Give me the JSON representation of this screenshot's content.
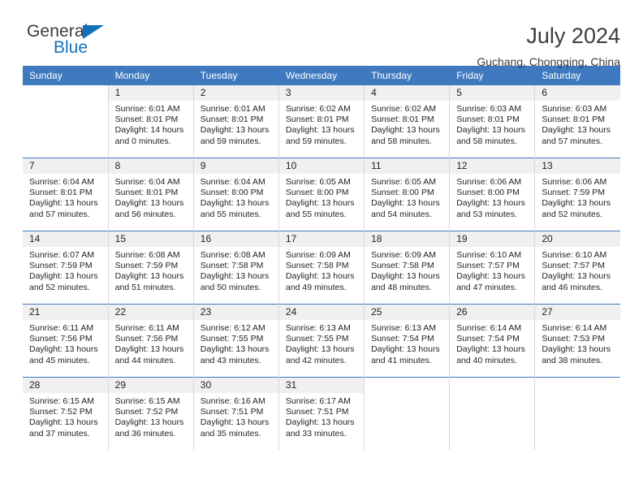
{
  "brand": {
    "name_part1": "General",
    "name_part2": "Blue"
  },
  "header": {
    "title": "July 2024",
    "location": "Guchang, Chongqing, China"
  },
  "weekday_headers": [
    "Sunday",
    "Monday",
    "Tuesday",
    "Wednesday",
    "Thursday",
    "Friday",
    "Saturday"
  ],
  "colors": {
    "header_blue": "#3f79bf",
    "brand_blue": "#1071b9",
    "daynum_band": "#f0f0f0",
    "text": "#231f20",
    "cell_divider": "#d8d8d8"
  },
  "weeks": [
    [
      {
        "day": "",
        "sunrise": "",
        "sunset": "",
        "daylight": "",
        "empty": true
      },
      {
        "day": "1",
        "sunrise": "Sunrise: 6:01 AM",
        "sunset": "Sunset: 8:01 PM",
        "daylight": "Daylight: 14 hours and 0 minutes."
      },
      {
        "day": "2",
        "sunrise": "Sunrise: 6:01 AM",
        "sunset": "Sunset: 8:01 PM",
        "daylight": "Daylight: 13 hours and 59 minutes."
      },
      {
        "day": "3",
        "sunrise": "Sunrise: 6:02 AM",
        "sunset": "Sunset: 8:01 PM",
        "daylight": "Daylight: 13 hours and 59 minutes."
      },
      {
        "day": "4",
        "sunrise": "Sunrise: 6:02 AM",
        "sunset": "Sunset: 8:01 PM",
        "daylight": "Daylight: 13 hours and 58 minutes."
      },
      {
        "day": "5",
        "sunrise": "Sunrise: 6:03 AM",
        "sunset": "Sunset: 8:01 PM",
        "daylight": "Daylight: 13 hours and 58 minutes."
      },
      {
        "day": "6",
        "sunrise": "Sunrise: 6:03 AM",
        "sunset": "Sunset: 8:01 PM",
        "daylight": "Daylight: 13 hours and 57 minutes."
      }
    ],
    [
      {
        "day": "7",
        "sunrise": "Sunrise: 6:04 AM",
        "sunset": "Sunset: 8:01 PM",
        "daylight": "Daylight: 13 hours and 57 minutes."
      },
      {
        "day": "8",
        "sunrise": "Sunrise: 6:04 AM",
        "sunset": "Sunset: 8:01 PM",
        "daylight": "Daylight: 13 hours and 56 minutes."
      },
      {
        "day": "9",
        "sunrise": "Sunrise: 6:04 AM",
        "sunset": "Sunset: 8:00 PM",
        "daylight": "Daylight: 13 hours and 55 minutes."
      },
      {
        "day": "10",
        "sunrise": "Sunrise: 6:05 AM",
        "sunset": "Sunset: 8:00 PM",
        "daylight": "Daylight: 13 hours and 55 minutes."
      },
      {
        "day": "11",
        "sunrise": "Sunrise: 6:05 AM",
        "sunset": "Sunset: 8:00 PM",
        "daylight": "Daylight: 13 hours and 54 minutes."
      },
      {
        "day": "12",
        "sunrise": "Sunrise: 6:06 AM",
        "sunset": "Sunset: 8:00 PM",
        "daylight": "Daylight: 13 hours and 53 minutes."
      },
      {
        "day": "13",
        "sunrise": "Sunrise: 6:06 AM",
        "sunset": "Sunset: 7:59 PM",
        "daylight": "Daylight: 13 hours and 52 minutes."
      }
    ],
    [
      {
        "day": "14",
        "sunrise": "Sunrise: 6:07 AM",
        "sunset": "Sunset: 7:59 PM",
        "daylight": "Daylight: 13 hours and 52 minutes."
      },
      {
        "day": "15",
        "sunrise": "Sunrise: 6:08 AM",
        "sunset": "Sunset: 7:59 PM",
        "daylight": "Daylight: 13 hours and 51 minutes."
      },
      {
        "day": "16",
        "sunrise": "Sunrise: 6:08 AM",
        "sunset": "Sunset: 7:58 PM",
        "daylight": "Daylight: 13 hours and 50 minutes."
      },
      {
        "day": "17",
        "sunrise": "Sunrise: 6:09 AM",
        "sunset": "Sunset: 7:58 PM",
        "daylight": "Daylight: 13 hours and 49 minutes."
      },
      {
        "day": "18",
        "sunrise": "Sunrise: 6:09 AM",
        "sunset": "Sunset: 7:58 PM",
        "daylight": "Daylight: 13 hours and 48 minutes."
      },
      {
        "day": "19",
        "sunrise": "Sunrise: 6:10 AM",
        "sunset": "Sunset: 7:57 PM",
        "daylight": "Daylight: 13 hours and 47 minutes."
      },
      {
        "day": "20",
        "sunrise": "Sunrise: 6:10 AM",
        "sunset": "Sunset: 7:57 PM",
        "daylight": "Daylight: 13 hours and 46 minutes."
      }
    ],
    [
      {
        "day": "21",
        "sunrise": "Sunrise: 6:11 AM",
        "sunset": "Sunset: 7:56 PM",
        "daylight": "Daylight: 13 hours and 45 minutes."
      },
      {
        "day": "22",
        "sunrise": "Sunrise: 6:11 AM",
        "sunset": "Sunset: 7:56 PM",
        "daylight": "Daylight: 13 hours and 44 minutes."
      },
      {
        "day": "23",
        "sunrise": "Sunrise: 6:12 AM",
        "sunset": "Sunset: 7:55 PM",
        "daylight": "Daylight: 13 hours and 43 minutes."
      },
      {
        "day": "24",
        "sunrise": "Sunrise: 6:13 AM",
        "sunset": "Sunset: 7:55 PM",
        "daylight": "Daylight: 13 hours and 42 minutes."
      },
      {
        "day": "25",
        "sunrise": "Sunrise: 6:13 AM",
        "sunset": "Sunset: 7:54 PM",
        "daylight": "Daylight: 13 hours and 41 minutes."
      },
      {
        "day": "26",
        "sunrise": "Sunrise: 6:14 AM",
        "sunset": "Sunset: 7:54 PM",
        "daylight": "Daylight: 13 hours and 40 minutes."
      },
      {
        "day": "27",
        "sunrise": "Sunrise: 6:14 AM",
        "sunset": "Sunset: 7:53 PM",
        "daylight": "Daylight: 13 hours and 38 minutes."
      }
    ],
    [
      {
        "day": "28",
        "sunrise": "Sunrise: 6:15 AM",
        "sunset": "Sunset: 7:52 PM",
        "daylight": "Daylight: 13 hours and 37 minutes."
      },
      {
        "day": "29",
        "sunrise": "Sunrise: 6:15 AM",
        "sunset": "Sunset: 7:52 PM",
        "daylight": "Daylight: 13 hours and 36 minutes."
      },
      {
        "day": "30",
        "sunrise": "Sunrise: 6:16 AM",
        "sunset": "Sunset: 7:51 PM",
        "daylight": "Daylight: 13 hours and 35 minutes."
      },
      {
        "day": "31",
        "sunrise": "Sunrise: 6:17 AM",
        "sunset": "Sunset: 7:51 PM",
        "daylight": "Daylight: 13 hours and 33 minutes."
      },
      {
        "day": "",
        "sunrise": "",
        "sunset": "",
        "daylight": "",
        "empty": true
      },
      {
        "day": "",
        "sunrise": "",
        "sunset": "",
        "daylight": "",
        "empty": true
      },
      {
        "day": "",
        "sunrise": "",
        "sunset": "",
        "daylight": "",
        "empty": true
      }
    ]
  ]
}
